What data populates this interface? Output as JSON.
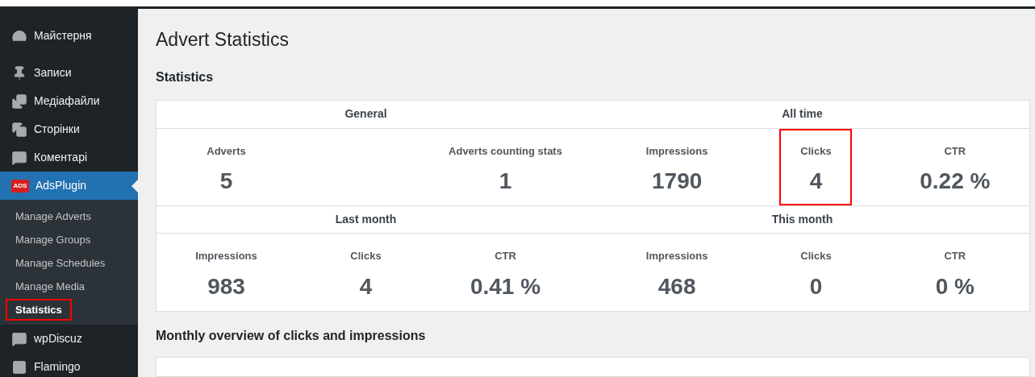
{
  "sidebar": {
    "items": [
      {
        "label": "Майстерня",
        "selected": false
      },
      {
        "label": "Записи",
        "selected": false
      },
      {
        "label": "Медіафайли",
        "selected": false
      },
      {
        "label": "Сторінки",
        "selected": false
      },
      {
        "label": "Коментарі",
        "selected": false
      },
      {
        "label": "AdsPlugin",
        "selected": true,
        "logo_text": "ADS",
        "children": [
          {
            "label": "Manage Adverts",
            "selected": false,
            "highlighted": false
          },
          {
            "label": "Manage Groups",
            "selected": false,
            "highlighted": false
          },
          {
            "label": "Manage Schedules",
            "selected": false,
            "highlighted": false
          },
          {
            "label": "Manage Media",
            "selected": false,
            "highlighted": false
          },
          {
            "label": "Statistics",
            "selected": true,
            "highlighted": true
          }
        ]
      },
      {
        "label": "wpDiscuz",
        "selected": false
      },
      {
        "label": "Flamingo",
        "selected": false
      }
    ]
  },
  "page_title": "Advert Statistics",
  "section_title": "Statistics",
  "stat_rows": [
    {
      "groups": [
        {
          "title": "General",
          "stats": [
            {
              "label": "Adverts",
              "value": "5",
              "highlighted": false
            },
            {
              "label": "Adverts counting stats",
              "value": "1",
              "highlighted": false
            }
          ]
        },
        {
          "title": "All time",
          "stats": [
            {
              "label": "Impressions",
              "value": "1790",
              "highlighted": false
            },
            {
              "label": "Clicks",
              "value": "4",
              "highlighted": true
            },
            {
              "label": "CTR",
              "value": "0.22 %",
              "highlighted": false
            }
          ]
        }
      ]
    },
    {
      "groups": [
        {
          "title": "Last month",
          "stats": [
            {
              "label": "Impressions",
              "value": "983",
              "highlighted": false
            },
            {
              "label": "Clicks",
              "value": "4",
              "highlighted": false
            },
            {
              "label": "CTR",
              "value": "0.41 %",
              "highlighted": false
            }
          ]
        },
        {
          "title": "This month",
          "stats": [
            {
              "label": "Impressions",
              "value": "468",
              "highlighted": false
            },
            {
              "label": "Clicks",
              "value": "0",
              "highlighted": false
            },
            {
              "label": "CTR",
              "value": "0 %",
              "highlighted": false
            }
          ]
        }
      ]
    }
  ],
  "overview_title": "Monthly overview of clicks and impressions"
}
